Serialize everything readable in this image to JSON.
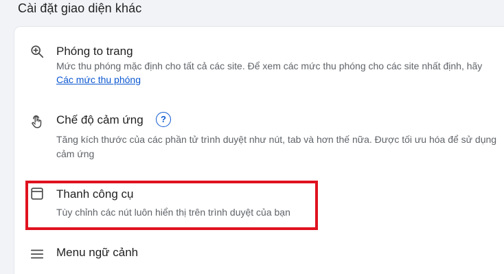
{
  "section": {
    "title": "Cài đặt giao diện khác"
  },
  "rows": {
    "zoom": {
      "icon": "zoom-in-icon",
      "title": "Phóng to trang",
      "description": "Mức thu phóng mặc định cho tất cả các site. Để xem các mức thu phóng cho các site nhất định, hãy",
      "link": "Các mức thu phóng"
    },
    "touch": {
      "icon": "touch-gesture-icon",
      "title": "Chế độ cảm ứng",
      "help_icon": "help-icon",
      "help_glyph": "?",
      "description": "Tăng kích thước của các phần tử trình duyệt như nút, tab và hơn thế nữa. Được tối ưu hóa để sử dụng cảm ứng"
    },
    "toolbar": {
      "icon": "toolbar-window-icon",
      "title": "Thanh công cụ",
      "description": "Tùy chỉnh các nút luôn hiển thị trên trình duyệt của bạn"
    },
    "context_menu": {
      "icon": "menu-lines-icon",
      "title": "Menu ngữ cảnh"
    }
  },
  "colors": {
    "highlight": "#e0121f",
    "link": "#0b57d0",
    "background": "#f1f3f7"
  }
}
